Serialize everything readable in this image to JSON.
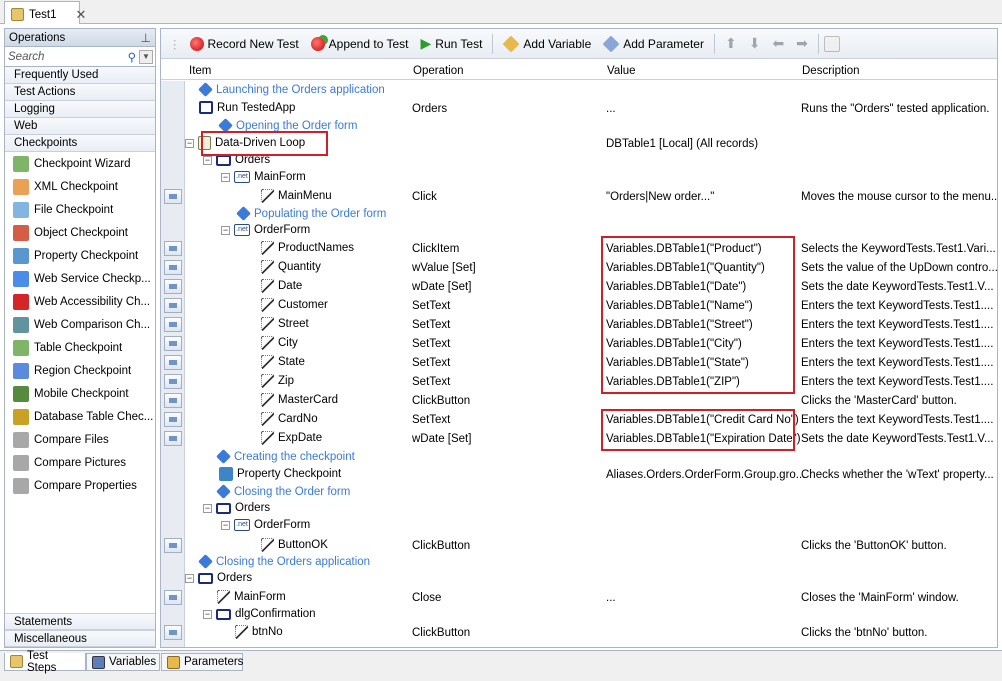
{
  "window": {
    "tab_title": "Test1"
  },
  "operations": {
    "title": "Operations",
    "search_placeholder": "Search",
    "categories_top": [
      "Frequently Used",
      "Test Actions",
      "Logging",
      "Web",
      "Checkpoints"
    ],
    "checkpoints": [
      {
        "label": "Checkpoint Wizard",
        "icon": "wand-icon",
        "color": "#6aa84f"
      },
      {
        "label": "XML Checkpoint",
        "icon": "xml-icon",
        "color": "#e69138"
      },
      {
        "label": "File Checkpoint",
        "icon": "file-icon",
        "color": "#6fa8dc"
      },
      {
        "label": "Object Checkpoint",
        "icon": "object-icon",
        "color": "#cc4125"
      },
      {
        "label": "Property Checkpoint",
        "icon": "property-icon",
        "color": "#3d85c6"
      },
      {
        "label": "Web Service Checkp...",
        "icon": "web-service-icon",
        "color": "#2b78e4"
      },
      {
        "label": "Web Accessibility Ch...",
        "icon": "accessibility-icon",
        "color": "#cc0000"
      },
      {
        "label": "Web Comparison Ch...",
        "icon": "web-compare-icon",
        "color": "#45818e"
      },
      {
        "label": "Table Checkpoint",
        "icon": "table-icon",
        "color": "#6aa84f"
      },
      {
        "label": "Region Checkpoint",
        "icon": "region-icon",
        "color": "#3c78d8"
      },
      {
        "label": "Mobile Checkpoint",
        "icon": "mobile-icon",
        "color": "#38761d"
      },
      {
        "label": "Database Table Chec...",
        "icon": "database-icon",
        "color": "#bf9000"
      },
      {
        "label": "Compare Files",
        "icon": "compare-files-icon",
        "color": "#999999"
      },
      {
        "label": "Compare Pictures",
        "icon": "compare-pictures-icon",
        "color": "#999999"
      },
      {
        "label": "Compare Properties",
        "icon": "compare-properties-icon",
        "color": "#999999"
      }
    ],
    "categories_bottom": [
      "Statements",
      "Miscellaneous"
    ]
  },
  "toolbar": {
    "record": "Record New Test",
    "append": "Append to Test",
    "run": "Run Test",
    "add_variable": "Add Variable",
    "add_parameter": "Add Parameter"
  },
  "columns": {
    "item": "Item",
    "operation": "Operation",
    "value": "Value",
    "description": "Description"
  },
  "rows": [
    {
      "item": "Launching  the Orders application",
      "op": "",
      "value": "",
      "desc": "",
      "comment": true
    },
    {
      "item": "Run TestedApp",
      "op": "Orders",
      "value": "...",
      "desc": "Runs the \"Orders\" tested application."
    },
    {
      "item": "Opening the Order form",
      "op": "",
      "value": "",
      "desc": "",
      "comment": true
    },
    {
      "item": "Data-Driven Loop",
      "op": "",
      "value": "DBTable1 [Local] (All records)",
      "desc": ""
    },
    {
      "item": "Orders",
      "op": "",
      "value": "",
      "desc": ""
    },
    {
      "item": "MainForm",
      "op": "",
      "value": "",
      "desc": ""
    },
    {
      "item": "MainMenu",
      "op": "Click",
      "value": "\"Orders|New order...\"",
      "desc": "Moves the mouse cursor to the menu..."
    },
    {
      "item": "Populating the Order form",
      "op": "",
      "value": "",
      "desc": "",
      "comment": true
    },
    {
      "item": "OrderForm",
      "op": "",
      "value": "",
      "desc": ""
    },
    {
      "item": "ProductNames",
      "op": "ClickItem",
      "value": "Variables.DBTable1(\"Product\")",
      "desc": "Selects the KeywordTests.Test1.Vari..."
    },
    {
      "item": "Quantity",
      "op": "wValue [Set]",
      "value": "Variables.DBTable1(\"Quantity\")",
      "desc": "Sets the value of the UpDown contro..."
    },
    {
      "item": "Date",
      "op": "wDate [Set]",
      "value": "Variables.DBTable1(\"Date\")",
      "desc": "Sets the date KeywordTests.Test1.V..."
    },
    {
      "item": "Customer",
      "op": "SetText",
      "value": "Variables.DBTable1(\"Name\")",
      "desc": "Enters the text KeywordTests.Test1...."
    },
    {
      "item": "Street",
      "op": "SetText",
      "value": "Variables.DBTable1(\"Street\")",
      "desc": "Enters the text KeywordTests.Test1...."
    },
    {
      "item": "City",
      "op": "SetText",
      "value": "Variables.DBTable1(\"City\")",
      "desc": "Enters the text KeywordTests.Test1...."
    },
    {
      "item": "State",
      "op": "SetText",
      "value": "Variables.DBTable1(\"State\")",
      "desc": "Enters the text KeywordTests.Test1...."
    },
    {
      "item": "Zip",
      "op": "SetText",
      "value": "Variables.DBTable1(\"ZIP\")",
      "desc": "Enters the text KeywordTests.Test1...."
    },
    {
      "item": "MasterCard",
      "op": "ClickButton",
      "value": "",
      "desc": "Clicks the 'MasterCard' button."
    },
    {
      "item": "CardNo",
      "op": "SetText",
      "value": "Variables.DBTable1(\"Credit Card No\")",
      "desc": "Enters the text KeywordTests.Test1...."
    },
    {
      "item": "ExpDate",
      "op": "wDate [Set]",
      "value": "Variables.DBTable1(\"Expiration Date\")",
      "desc": "Sets the date KeywordTests.Test1.V..."
    },
    {
      "item": "Creating the checkpoint",
      "op": "",
      "value": "",
      "desc": "",
      "comment": true
    },
    {
      "item": "Property Checkpoint",
      "op": "",
      "value": "Aliases.Orders.OrderForm.Group.gro...",
      "desc": "Checks whether the 'wText' property..."
    },
    {
      "item": "Closing the Order form",
      "op": "",
      "value": "",
      "desc": "",
      "comment": true
    },
    {
      "item": "Orders",
      "op": "",
      "value": "",
      "desc": ""
    },
    {
      "item": "OrderForm",
      "op": "",
      "value": "",
      "desc": ""
    },
    {
      "item": "ButtonOK",
      "op": "ClickButton",
      "value": "",
      "desc": "Clicks the 'ButtonOK' button."
    },
    {
      "item": "Closing the Orders application",
      "op": "",
      "value": "",
      "desc": "",
      "comment": true
    },
    {
      "item": "Orders",
      "op": "",
      "value": "",
      "desc": ""
    },
    {
      "item": "MainForm",
      "op": "Close",
      "value": "...",
      "desc": "Closes the 'MainForm' window."
    },
    {
      "item": "dlgConfirmation",
      "op": "",
      "value": "",
      "desc": ""
    },
    {
      "item": "btnNo",
      "op": "ClickButton",
      "value": "",
      "desc": "Clicks the 'btnNo' button."
    }
  ],
  "net_badge": ".net",
  "bottom_tabs": [
    "Test Steps",
    "Variables",
    "Parameters"
  ],
  "colors": {
    "highlight": "#d11f2a",
    "comment": "#3a7ad8"
  }
}
